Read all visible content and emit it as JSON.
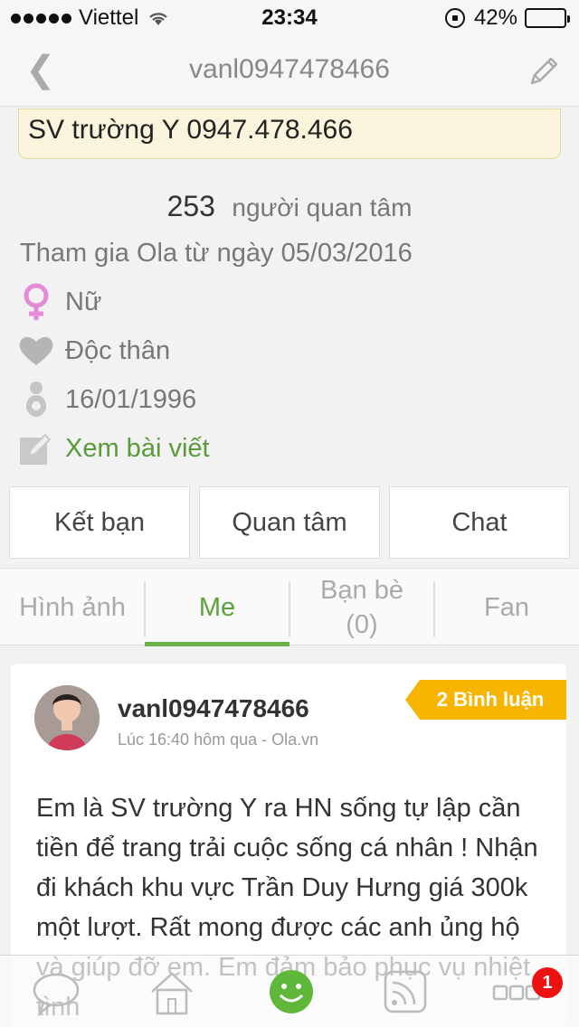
{
  "status_bar": {
    "carrier": "Viettel",
    "time": "23:34",
    "battery": "42%",
    "battery_level": 0.42
  },
  "nav": {
    "title": "vanl0947478466"
  },
  "profile": {
    "bio": "SV trường Y 0947.478.466",
    "followers_count": "253",
    "followers_label": "người quan tâm",
    "joined": "Tham gia Ola từ ngày 05/03/2016",
    "gender": "Nữ",
    "relationship": "Độc thân",
    "birthday": "16/01/1996",
    "view_posts": "Xem bài viết"
  },
  "actions": {
    "add_friend": "Kết bạn",
    "follow": "Quan tâm",
    "chat": "Chat"
  },
  "tabs": [
    {
      "label": "Hình ảnh"
    },
    {
      "label": "Me"
    },
    {
      "label": "Bạn bè\n(0)"
    },
    {
      "label": "Fan"
    }
  ],
  "post": {
    "username": "vanl0947478466",
    "time": "Lúc 16:40 hôm qua - Ola.vn",
    "comments": "2 Bình luận",
    "body": "Em là SV trường Y ra HN sống tự lập cần tiền để trang trải cuộc sống cá nhân ! Nhận đi khách khu vực Trần Duy Hưng giá 300k một lượt. Rất mong được các anh ủng hộ và giúp đỡ em. Em đảm bảo phục vụ nhiệt tình"
  },
  "bottom_bar": {
    "notification_count": "1"
  },
  "colors": {
    "accent_green": "#6ab04c",
    "badge_orange": "#f7b500",
    "notification_red": "#e11111",
    "gender_pink": "#e68bd8"
  }
}
